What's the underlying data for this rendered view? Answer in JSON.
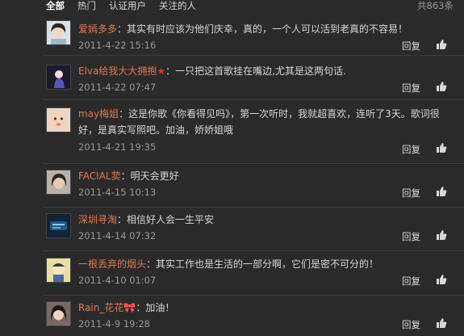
{
  "tabs": [
    {
      "label": "全部",
      "active": true
    },
    {
      "label": "热门",
      "active": false
    },
    {
      "label": "认证用户",
      "active": false
    },
    {
      "label": "关注的人",
      "active": false
    }
  ],
  "total_label": "共863条",
  "comments": [
    {
      "name": "爱嫣多多",
      "content": "：其实有时应该为他们庆幸，真的，一个人可以活到老真的不容易！",
      "time": "2011-4-22 15:16",
      "reply": "回复",
      "avatar": "girl-portrait"
    },
    {
      "name": "Elva给我大大拥抱",
      "badge": "★",
      "content": "：一只把这首歌挂在嘴边,尤其是这两句话.",
      "time": "2011-4-22 07:47",
      "reply": "回复",
      "avatar": "anime-figure"
    },
    {
      "name": "may梅姐",
      "content": "：这是你歌《你看得见吗》，第一次听时，我就超喜欢，连听了3天。歌词很好，是真实写照吧。加油，娇娇姐哦",
      "time": "2011-4-21 19:35",
      "reply": "回复",
      "avatar": "baby-face"
    },
    {
      "name": "FACIAL荬",
      "content": "：明天会更好",
      "time": "2011-4-15 10:13",
      "reply": "回复",
      "avatar": "woman-portrait"
    },
    {
      "name": "深圳寻淘",
      "content": "：相信好人会一生平安",
      "time": "2011-4-14 07:32",
      "reply": "回复",
      "avatar": "dark-blue-logo"
    },
    {
      "name": "一根丢弃的烟头",
      "content": "：其实工作也是生活的一部分啊，它们是密不可分的！",
      "time": "2011-4-10 01:07",
      "reply": "回复",
      "avatar": "cartoon-character"
    },
    {
      "name": "Rain_花花",
      "badge": "🎀",
      "content": "：加油！",
      "time": "2011-4-9 19:28",
      "reply": "回复",
      "avatar": "girl-portrait-2"
    }
  ]
}
